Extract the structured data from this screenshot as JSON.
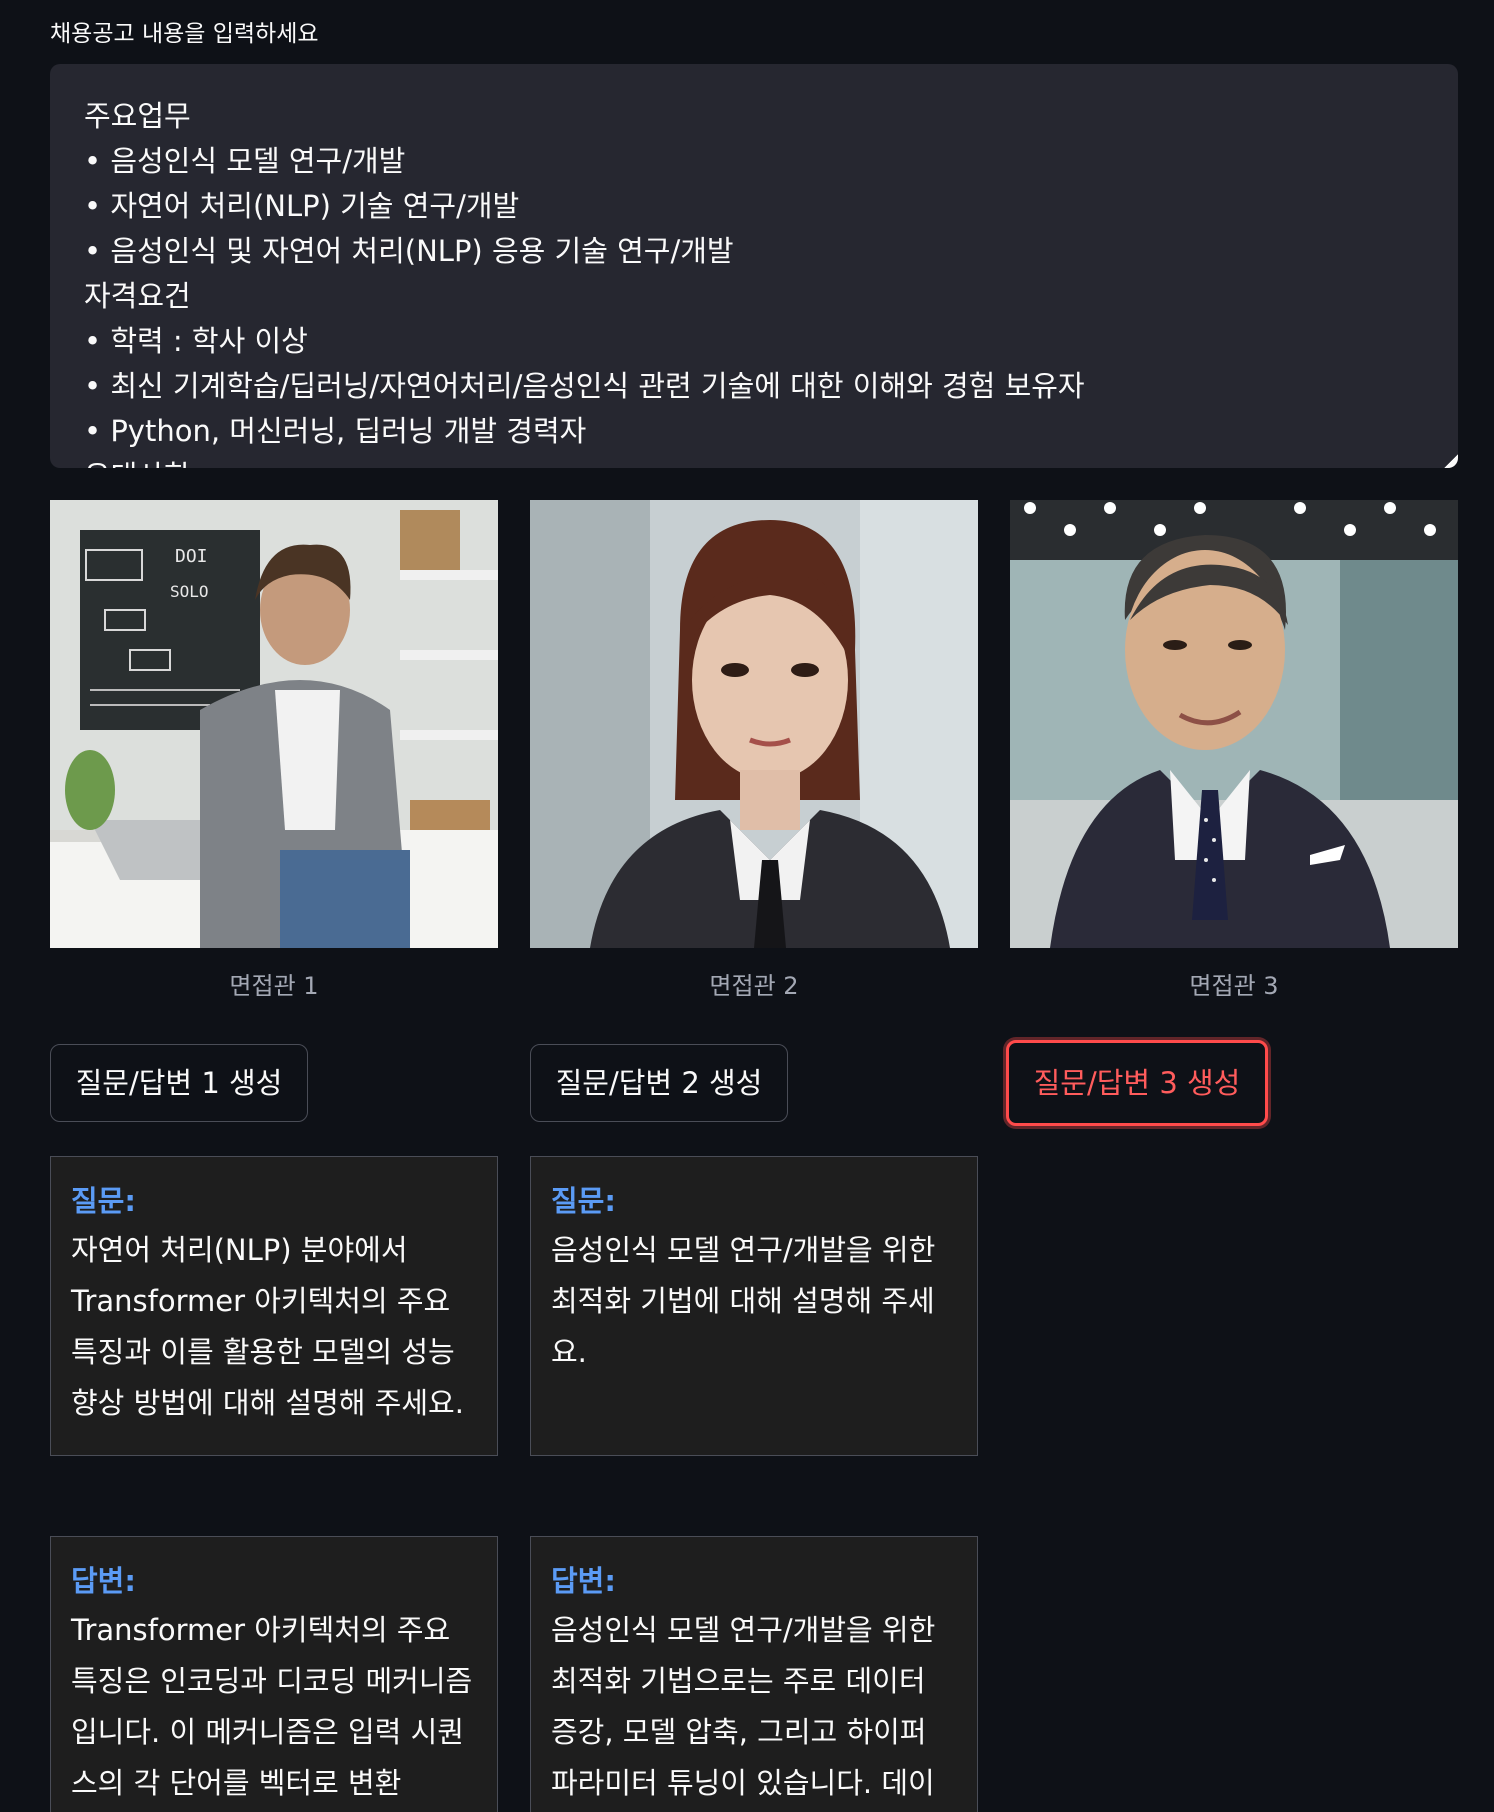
{
  "job_input": {
    "label": "채용공고 내용을 입력하세요",
    "lines": [
      "주요업무",
      "• 음성인식 모델 연구/개발",
      "• 자연어 처리(NLP) 기술 연구/개발",
      "• 음성인식 및 자연어 처리(NLP) 응용 기술 연구/개발",
      "자격요건",
      "• 학력 : 학사 이상",
      "• 최신 기계학습/딥러닝/자연어처리/음성인식 관련 기술에 대한 이해와 경험 보유자",
      "• Python, 머신러닝, 딥러닝 개발 경력자",
      "우대사항"
    ]
  },
  "interviewers": [
    {
      "caption": "면접관 1",
      "button": "질문/답변 1 생성",
      "question_title": "질문:",
      "question": "자연어 처리(NLP) 분야에서 Transformer 아키텍처의 주요 특징과 이를 활용한 모델의 성능 향상 방법에 대해 설명해 주세요.",
      "answer_title": "답변:",
      "answer": "Transformer 아키텍처의 주요 특징은 인코딩과 디코딩 메커니즘입니다. 이 메커니즘은 입력 시퀀스의 각 단어를 벡터로 변환"
    },
    {
      "caption": "면접관 2",
      "button": "질문/답변 2 생성",
      "question_title": "질문:",
      "question": "음성인식 모델 연구/개발을 위한 최적화 기법에 대해 설명해 주세요.",
      "answer_title": "답변:",
      "answer": "음성인식 모델 연구/개발을 위한 최적화 기법으로는 주로 데이터 증강, 모델 압축, 그리고 하이퍼 파라미터 튜닝이 있습니다. 데이"
    },
    {
      "caption": "면접관 3",
      "button": "질문/답변 3 생성"
    }
  ],
  "colors": {
    "background": "#0e1117",
    "accent_red": "#ff4b4b",
    "title_blue": "#5b9bf5"
  }
}
